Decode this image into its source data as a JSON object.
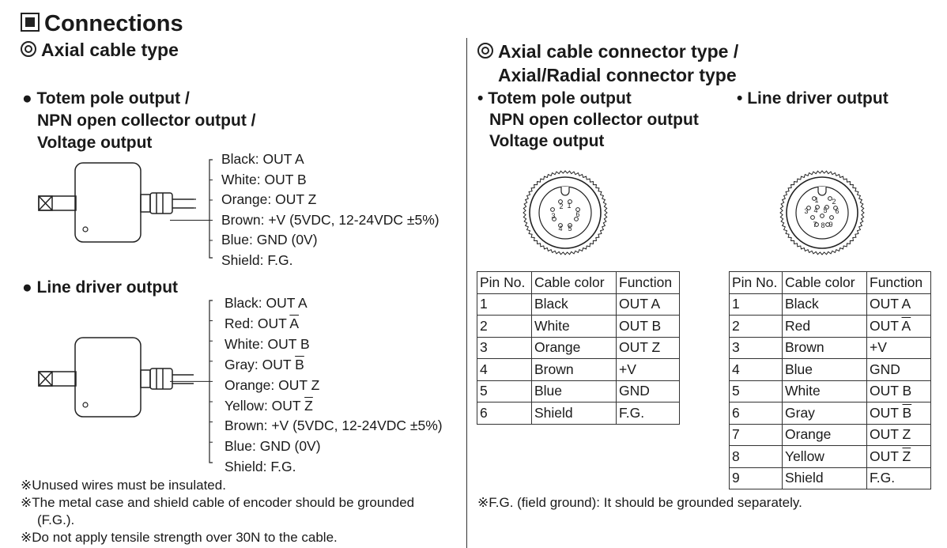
{
  "title": "Connections",
  "left": {
    "section_title": "Axial cable type",
    "totem": {
      "heading_lines": [
        "Totem pole output /",
        "NPN open collector output /",
        "Voltage output"
      ],
      "wires": [
        {
          "label": "Black: OUT A",
          "bar": ""
        },
        {
          "label": "White: OUT B",
          "bar": ""
        },
        {
          "label": "Orange: OUT Z",
          "bar": ""
        },
        {
          "label": "Brown: +V (5VDC, 12-24VDC ±5%)",
          "bar": ""
        },
        {
          "label": "Blue: GND (0V)",
          "bar": ""
        },
        {
          "label": "Shield: F.G.",
          "bar": ""
        }
      ]
    },
    "line_driver": {
      "heading": "Line driver output",
      "wires": [
        {
          "label": "Black: OUT A",
          "bar": ""
        },
        {
          "label": "Red: OUT ",
          "bar": "A"
        },
        {
          "label": "White: OUT B",
          "bar": ""
        },
        {
          "label": "Gray: OUT ",
          "bar": "B"
        },
        {
          "label": "Orange: OUT Z",
          "bar": ""
        },
        {
          "label": "Yellow: OUT ",
          "bar": "Z"
        },
        {
          "label": "Brown: +V (5VDC, 12-24VDC ±5%)",
          "bar": ""
        },
        {
          "label": "Blue: GND (0V)",
          "bar": ""
        },
        {
          "label": "Shield: F.G.",
          "bar": ""
        }
      ]
    },
    "notes": [
      "※Unused wires must be insulated.",
      "※The metal case and shield cable of encoder should be grounded",
      "(F.G.).",
      "※Do not apply tensile strength over 30N to the cable."
    ]
  },
  "right": {
    "section_title_lines": [
      "Axial cable connector type /",
      "Axial/Radial connector type"
    ],
    "totem_heading_lines": [
      "Totem pole output",
      "NPN open collector output",
      "Voltage output"
    ],
    "line_driver_heading": "Line driver output",
    "connector_6pin_labels": [
      "1",
      "2",
      "3",
      "4",
      "5",
      "6"
    ],
    "connector_9pin_labels": [
      "1",
      "2",
      "3",
      "4",
      "5",
      "6",
      "7",
      "8",
      "9"
    ],
    "table_headers": [
      "Pin No.",
      "Cable color",
      "Function"
    ],
    "table_totem": [
      {
        "pin": "1",
        "color": "Black",
        "func": "OUT A",
        "bar": ""
      },
      {
        "pin": "2",
        "color": "White",
        "func": "OUT B",
        "bar": ""
      },
      {
        "pin": "3",
        "color": "Orange",
        "func": "OUT Z",
        "bar": ""
      },
      {
        "pin": "4",
        "color": "Brown",
        "func": "+V",
        "bar": ""
      },
      {
        "pin": "5",
        "color": "Blue",
        "func": "GND",
        "bar": ""
      },
      {
        "pin": "6",
        "color": "Shield",
        "func": "F.G.",
        "bar": ""
      }
    ],
    "table_line_driver": [
      {
        "pin": "1",
        "color": "Black",
        "func": "OUT A",
        "bar": ""
      },
      {
        "pin": "2",
        "color": "Red",
        "func": "OUT ",
        "bar": "A"
      },
      {
        "pin": "3",
        "color": "Brown",
        "func": "+V",
        "bar": ""
      },
      {
        "pin": "4",
        "color": "Blue",
        "func": "GND",
        "bar": ""
      },
      {
        "pin": "5",
        "color": "White",
        "func": "OUT B",
        "bar": ""
      },
      {
        "pin": "6",
        "color": "Gray",
        "func": "OUT ",
        "bar": "B"
      },
      {
        "pin": "7",
        "color": "Orange",
        "func": "OUT Z",
        "bar": ""
      },
      {
        "pin": "8",
        "color": "Yellow",
        "func": "OUT ",
        "bar": "Z"
      },
      {
        "pin": "9",
        "color": "Shield",
        "func": "F.G.",
        "bar": ""
      }
    ],
    "note": "※F.G. (field ground): It should be grounded separately."
  },
  "icons": {
    "title_marker": "filled-square-icon",
    "section_marker": "double-circle-icon",
    "bullet": "bullet-icon"
  }
}
